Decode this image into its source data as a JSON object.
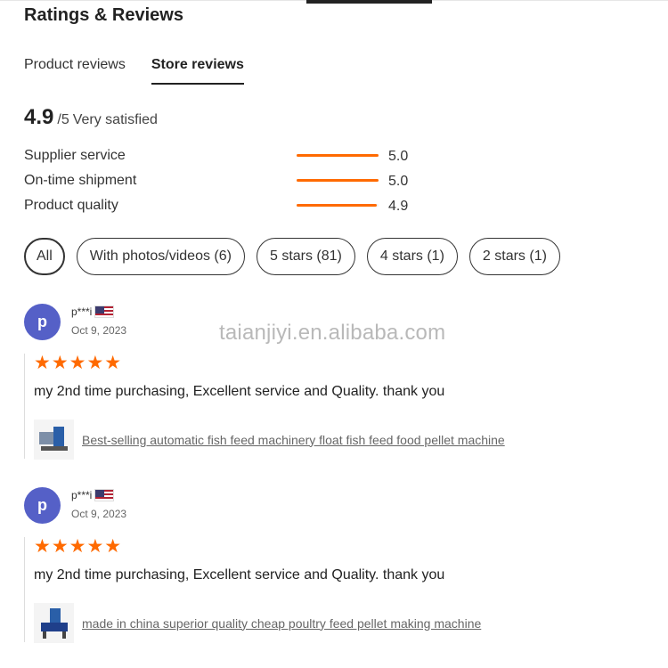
{
  "header": {
    "title": "Ratings & Reviews"
  },
  "tabs": [
    {
      "label": "Product reviews",
      "active": false
    },
    {
      "label": "Store reviews",
      "active": true
    }
  ],
  "overall": {
    "score": "4.9",
    "out_of": "/5",
    "description": "Very satisfied"
  },
  "metrics": [
    {
      "label": "Supplier service",
      "value": "5.0",
      "fill_fraction": 1.0
    },
    {
      "label": "On-time shipment",
      "value": "5.0",
      "fill_fraction": 1.0
    },
    {
      "label": "Product quality",
      "value": "4.9",
      "fill_fraction": 0.98
    }
  ],
  "filters": [
    {
      "label": "All",
      "active": true
    },
    {
      "label": "With photos/videos (6)",
      "active": false
    },
    {
      "label": "5 stars (81)",
      "active": false
    },
    {
      "label": "4 stars (1)",
      "active": false
    },
    {
      "label": "2 stars (1)",
      "active": false
    }
  ],
  "watermark": "taianjiyi.en.alibaba.com",
  "reviews": [
    {
      "avatar_letter": "p",
      "name": "p***i",
      "date": "Oct 9, 2023",
      "rating": 5,
      "stars": "★★★★★",
      "text": "my 2nd time purchasing, Excellent service and Quality. thank you",
      "product": "Best-selling automatic fish feed machinery float fish feed food pellet machine",
      "flag_icon": "us-flag-icon"
    },
    {
      "avatar_letter": "p",
      "name": "p***i",
      "date": "Oct 9, 2023",
      "rating": 5,
      "stars": "★★★★★",
      "text": "my 2nd time purchasing, Excellent service and Quality. thank you",
      "product": "made in china superior quality cheap poultry feed pellet making machine",
      "flag_icon": "us-flag-icon"
    }
  ],
  "colors": {
    "accent": "#ff6a00",
    "avatar": "#5560c7"
  }
}
